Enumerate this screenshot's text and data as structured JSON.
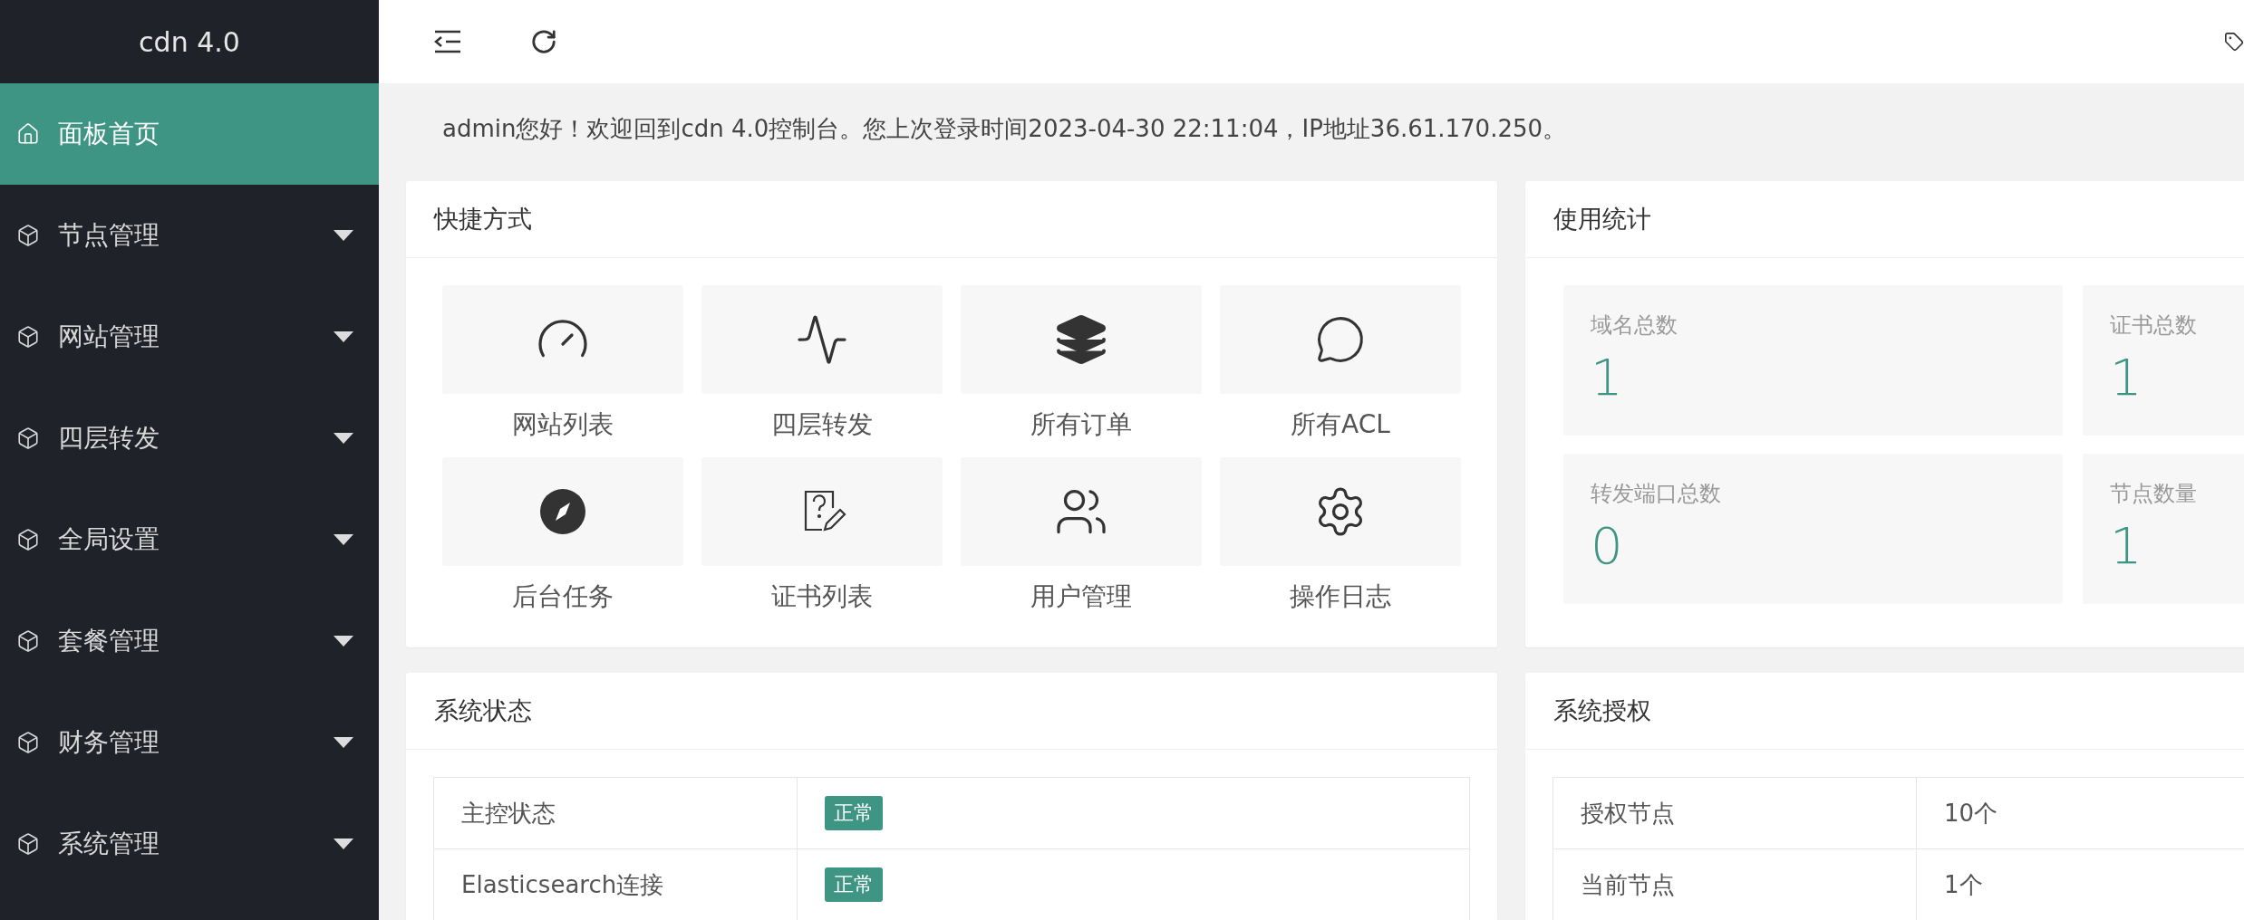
{
  "sidebar": {
    "logo": "cdn 4.0",
    "items": [
      {
        "label": "面板首页",
        "kind": "link",
        "selected": true
      },
      {
        "label": "节点管理",
        "kind": "group",
        "selected": false
      },
      {
        "label": "网站管理",
        "kind": "group",
        "selected": false
      },
      {
        "label": "四层转发",
        "kind": "group",
        "selected": false
      },
      {
        "label": "全局设置",
        "kind": "group",
        "selected": false
      },
      {
        "label": "套餐管理",
        "kind": "group",
        "selected": false
      },
      {
        "label": "财务管理",
        "kind": "group",
        "selected": false
      },
      {
        "label": "系统管理",
        "kind": "group",
        "selected": false
      }
    ]
  },
  "welcome": "admin您好！欢迎回到cdn 4.0控制台。您上次登录时间2023-04-30 22:11:04，IP地址36.61.170.250。",
  "shortcuts": {
    "title": "快捷方式",
    "items": [
      "网站列表",
      "四层转发",
      "所有订单",
      "所有ACL",
      "后台任务",
      "证书列表",
      "用户管理",
      "操作日志"
    ]
  },
  "stats": {
    "title": "使用统计",
    "items": [
      {
        "label": "域名总数",
        "value": "1"
      },
      {
        "label": "证书总数",
        "value": "1"
      },
      {
        "label": "转发端口总数",
        "value": "0"
      },
      {
        "label": "节点数量",
        "value": "1"
      }
    ]
  },
  "system_status": {
    "title": "系统状态",
    "rows": [
      {
        "label": "主控状态",
        "value": "正常",
        "kind": "badge"
      },
      {
        "label": "Elasticsearch连接",
        "value": "正常",
        "kind": "badge"
      }
    ]
  },
  "license": {
    "title": "系统授权",
    "rows": [
      {
        "label": "授权节点",
        "value": "10个",
        "kind": "text"
      },
      {
        "label": "当前节点",
        "value": "1个",
        "kind": "text"
      }
    ]
  }
}
